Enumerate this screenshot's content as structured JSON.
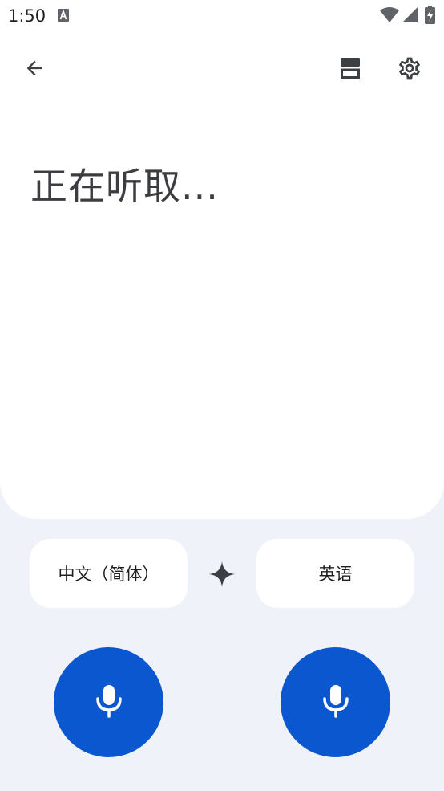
{
  "status_bar": {
    "time": "1:50"
  },
  "toolbar": {
    "back_icon": "arrow-back-icon",
    "view_icon": "view-split-icon",
    "settings_icon": "gear-icon"
  },
  "main": {
    "listening_text": "正在听取..."
  },
  "languages": {
    "source": "中文（简体）",
    "target": "英语",
    "sparkle_icon": "sparkle-icon"
  },
  "colors": {
    "accent": "#0b57d0",
    "background": "#eff2f8",
    "card": "#ffffff"
  }
}
